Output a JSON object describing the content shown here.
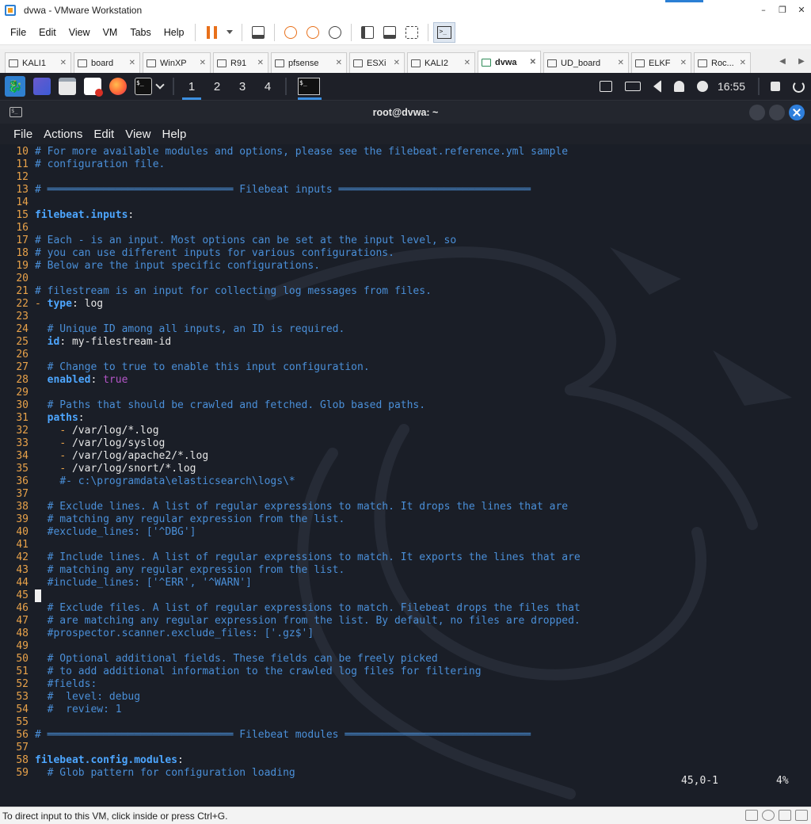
{
  "vmware": {
    "window_title": "dvwa - VMware Workstation",
    "window_controls": {
      "minimize": "–",
      "restore": "❐",
      "close": "✕"
    },
    "menu": [
      "File",
      "Edit",
      "View",
      "VM",
      "Tabs",
      "Help"
    ],
    "tabs": [
      {
        "label": "KALI1",
        "active": false
      },
      {
        "label": "board",
        "active": false
      },
      {
        "label": "WinXP",
        "active": false
      },
      {
        "label": "R91",
        "active": false
      },
      {
        "label": "pfsense",
        "active": false
      },
      {
        "label": "ESXi",
        "active": false
      },
      {
        "label": "KALI2",
        "active": false
      },
      {
        "label": "dvwa",
        "active": true
      },
      {
        "label": "UD_board",
        "active": false
      },
      {
        "label": "ELKF",
        "active": false
      },
      {
        "label": "Roc...",
        "active": false
      }
    ],
    "tab_close_glyph": "✕",
    "tab_scroll": {
      "left": "◀",
      "right": "▶"
    },
    "status_text": "To direct input to this VM, click inside or press Ctrl+G."
  },
  "kali_panel": {
    "logo_glyph": "🐉",
    "term_glyph": "$_",
    "workspaces": [
      "1",
      "2",
      "3",
      "4"
    ],
    "active_workspace": "1",
    "clock": "16:55"
  },
  "terminal": {
    "icon_glyph": "$_",
    "title": "root@dvwa: ~",
    "menu": [
      "File",
      "Actions",
      "Edit",
      "View",
      "Help"
    ],
    "status_position": "45,0-1",
    "status_percent": "4%"
  },
  "lines": [
    {
      "n": "10",
      "cm": "# For more available modules and options, please see the filebeat.reference.yml sample"
    },
    {
      "n": "11",
      "cm": "# configuration file."
    },
    {
      "n": "12"
    },
    {
      "n": "13",
      "cm": "# ══════════════════════════════ Filebeat inputs ═══════════════════════════════"
    },
    {
      "n": "14"
    },
    {
      "n": "15",
      "key": "filebeat.inputs",
      "val": ":"
    },
    {
      "n": "16"
    },
    {
      "n": "17",
      "cm": "# Each - is an input. Most options can be set at the input level, so"
    },
    {
      "n": "18",
      "cm": "# you can use different inputs for various configurations."
    },
    {
      "n": "19",
      "cm": "# Below are the input specific configurations."
    },
    {
      "n": "20"
    },
    {
      "n": "21",
      "cm": "# filestream is an input for collecting log messages from files."
    },
    {
      "n": "22",
      "dash": "- ",
      "key": "type",
      "val": ": log"
    },
    {
      "n": "23"
    },
    {
      "n": "24",
      "ind": "  ",
      "cm": "# Unique ID among all inputs, an ID is required."
    },
    {
      "n": "25",
      "ind": "  ",
      "key": "id",
      "val": ": my-filestream-id"
    },
    {
      "n": "26"
    },
    {
      "n": "27",
      "ind": "  ",
      "cm": "# Change to true to enable this input configuration."
    },
    {
      "n": "28",
      "ind": "  ",
      "key": "enabled",
      "val": ": ",
      "pu": "true"
    },
    {
      "n": "29"
    },
    {
      "n": "30",
      "ind": "  ",
      "cm": "# Paths that should be crawled and fetched. Glob based paths."
    },
    {
      "n": "31",
      "ind": "  ",
      "key": "paths",
      "val": ":"
    },
    {
      "n": "32",
      "ind": "    ",
      "dash": "- ",
      "val": "/var/log/*.log"
    },
    {
      "n": "33",
      "ind": "    ",
      "dash": "- ",
      "val": "/var/log/syslog"
    },
    {
      "n": "34",
      "ind": "    ",
      "dash": "- ",
      "val": "/var/log/apache2/*.log"
    },
    {
      "n": "35",
      "ind": "    ",
      "dash": "- ",
      "val": "/var/log/snort/*.log"
    },
    {
      "n": "36",
      "ind": "    ",
      "cm": "#- c:\\programdata\\elasticsearch\\logs\\*"
    },
    {
      "n": "37"
    },
    {
      "n": "38",
      "ind": "  ",
      "cm": "# Exclude lines. A list of regular expressions to match. It drops the lines that are"
    },
    {
      "n": "39",
      "ind": "  ",
      "cm": "# matching any regular expression from the list."
    },
    {
      "n": "40",
      "ind": "  ",
      "cm": "#exclude_lines: ['^DBG']"
    },
    {
      "n": "41"
    },
    {
      "n": "42",
      "ind": "  ",
      "cm": "# Include lines. A list of regular expressions to match. It exports the lines that are"
    },
    {
      "n": "43",
      "ind": "  ",
      "cm": "# matching any regular expression from the list."
    },
    {
      "n": "44",
      "ind": "  ",
      "cm": "#include_lines: ['^ERR', '^WARN']"
    },
    {
      "n": "45",
      "cursor": true
    },
    {
      "n": "46",
      "ind": "  ",
      "cm": "# Exclude files. A list of regular expressions to match. Filebeat drops the files that"
    },
    {
      "n": "47",
      "ind": "  ",
      "cm": "# are matching any regular expression from the list. By default, no files are dropped."
    },
    {
      "n": "48",
      "ind": "  ",
      "cm": "#prospector.scanner.exclude_files: ['.gz$']"
    },
    {
      "n": "49"
    },
    {
      "n": "50",
      "ind": "  ",
      "cm": "# Optional additional fields. These fields can be freely picked"
    },
    {
      "n": "51",
      "ind": "  ",
      "cm": "# to add additional information to the crawled log files for filtering"
    },
    {
      "n": "52",
      "ind": "  ",
      "cm": "#fields:"
    },
    {
      "n": "53",
      "ind": "  ",
      "cm": "#  level: debug"
    },
    {
      "n": "54",
      "ind": "  ",
      "cm": "#  review: 1"
    },
    {
      "n": "55"
    },
    {
      "n": "56",
      "cm": "# ══════════════════════════════ Filebeat modules ══════════════════════════════"
    },
    {
      "n": "57"
    },
    {
      "n": "58",
      "key": "filebeat.config.modules",
      "val": ":"
    },
    {
      "n": "59",
      "ind": "  ",
      "cm": "# Glob pattern for configuration loading"
    }
  ]
}
